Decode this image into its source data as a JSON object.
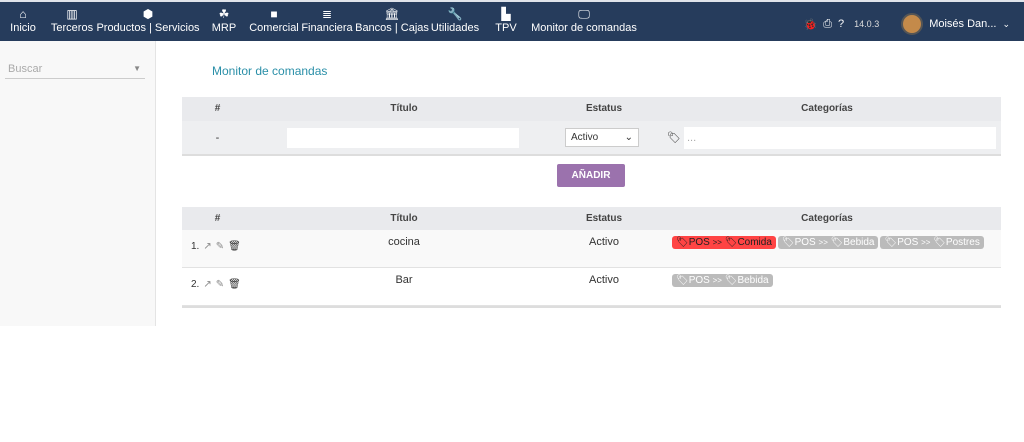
{
  "nav": [
    {
      "icon": "home-icon",
      "glyph": "⌂",
      "label": "Inicio"
    },
    {
      "icon": "building-icon",
      "glyph": "▥",
      "label": "Terceros"
    },
    {
      "icon": "cube-icon",
      "glyph": "⬢",
      "label": "Productos | Servicios"
    },
    {
      "icon": "cubes-icon",
      "glyph": "☘",
      "label": "MRP"
    },
    {
      "icon": "briefcase-icon",
      "glyph": "■",
      "label": "Comercial"
    },
    {
      "icon": "coins-icon",
      "glyph": "≣",
      "label": "Financiera"
    },
    {
      "icon": "bank-icon",
      "glyph": "🏛",
      "label": "Bancos | Cajas"
    },
    {
      "icon": "wrench-icon",
      "glyph": "🔧",
      "label": "Utilidades"
    },
    {
      "icon": "cash-register-icon",
      "glyph": "▙",
      "label": "TPV"
    },
    {
      "icon": "monitor-icon",
      "glyph": "🖵",
      "label": "Monitor de comandas"
    }
  ],
  "topright": {
    "version": "14.0.3",
    "user": "Moisés Dan..."
  },
  "sidebar": {
    "search_placeholder": "Buscar"
  },
  "page_title": "Monitor de comandas",
  "columns": {
    "num": "#",
    "title": "Título",
    "status": "Estatus",
    "categories": "Categorías"
  },
  "form": {
    "num": "-",
    "title_value": "",
    "status": "Activo",
    "categories_placeholder": "...",
    "add_label": "AÑADIR"
  },
  "rows": [
    {
      "num": "1.",
      "title": "cocina",
      "status": "Activo",
      "tags": [
        {
          "a": "POS",
          "b": "Comida",
          "active": true
        },
        {
          "a": "POS",
          "b": "Bebida",
          "active": false
        },
        {
          "a": "POS",
          "b": "Postres",
          "active": false
        }
      ]
    },
    {
      "num": "2.",
      "title": "Bar",
      "status": "Activo",
      "tags": [
        {
          "a": "POS",
          "b": "Bebida",
          "active": false
        }
      ]
    }
  ],
  "sep": ">>",
  "colors": {
    "topbar": "#263c5c",
    "accent": "#9b72ad",
    "title": "#2a8fa8",
    "active_tag": "#ff4444"
  }
}
